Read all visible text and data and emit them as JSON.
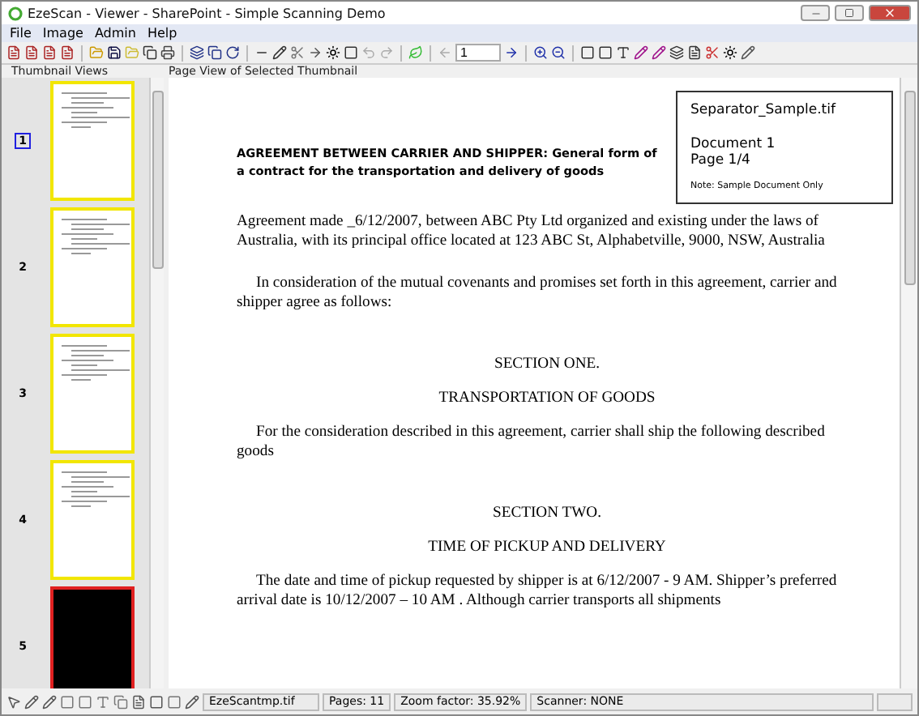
{
  "window": {
    "title": "EzeScan - Viewer - SharePoint - Simple Scanning Demo"
  },
  "menu": [
    "File",
    "Image",
    "Admin",
    "Help"
  ],
  "toolbar": {
    "page_value": "1"
  },
  "thumbnail_panel": {
    "title": "Thumbnail Views",
    "thumbnails": [
      {
        "number": "1",
        "selected": true,
        "color": "#f2e600",
        "kind": "page"
      },
      {
        "number": "2",
        "selected": false,
        "color": "#f2e600",
        "kind": "page"
      },
      {
        "number": "3",
        "selected": false,
        "color": "#f2e600",
        "kind": "page"
      },
      {
        "number": "4",
        "selected": false,
        "color": "#f2e600",
        "kind": "page"
      },
      {
        "number": "5",
        "selected": false,
        "color": "#e02020",
        "kind": "black"
      }
    ]
  },
  "page_view": {
    "title": "Page View of Selected Thumbnail",
    "separator": {
      "filename": "Separator_Sample.tif",
      "document": "Document 1",
      "page": "Page 1/4",
      "note": "Note: Sample Document Only"
    },
    "heading": "AGREEMENT BETWEEN CARRIER AND SHIPPER:  General form of a contract for the transportation and delivery of goods",
    "blocks": [
      {
        "kind": "para",
        "text": "Agreement made  _6/12/2007, between  ABC Pty Ltd  organized and existing under the laws of Australia, with its principal office located at 123 ABC St, Alphabetville, 9000, NSW, Australia"
      },
      {
        "kind": "para",
        "text": "In consideration of the mutual covenants and promises set forth in this agreement, carrier and shipper agree as follows:"
      },
      {
        "kind": "section",
        "text": "SECTION ONE."
      },
      {
        "kind": "section",
        "text": "TRANSPORTATION OF GOODS"
      },
      {
        "kind": "para",
        "text": "For the consideration described in this agreement, carrier shall ship the following described goods"
      },
      {
        "kind": "section",
        "text": "SECTION TWO."
      },
      {
        "kind": "section",
        "text": "TIME OF PICKUP AND DELIVERY"
      },
      {
        "kind": "para",
        "text": "The date and time of pickup requested by shipper is at 6/12/2007 - 9 AM. Shipper’s preferred arrival date is 10/12/2007 – 10 AM . Although carrier transports all shipments"
      }
    ]
  },
  "status_bar": [
    "EzeScantmp.tif",
    "Pages: 11",
    "Zoom factor: 35.92%",
    "Scanner: NONE"
  ]
}
